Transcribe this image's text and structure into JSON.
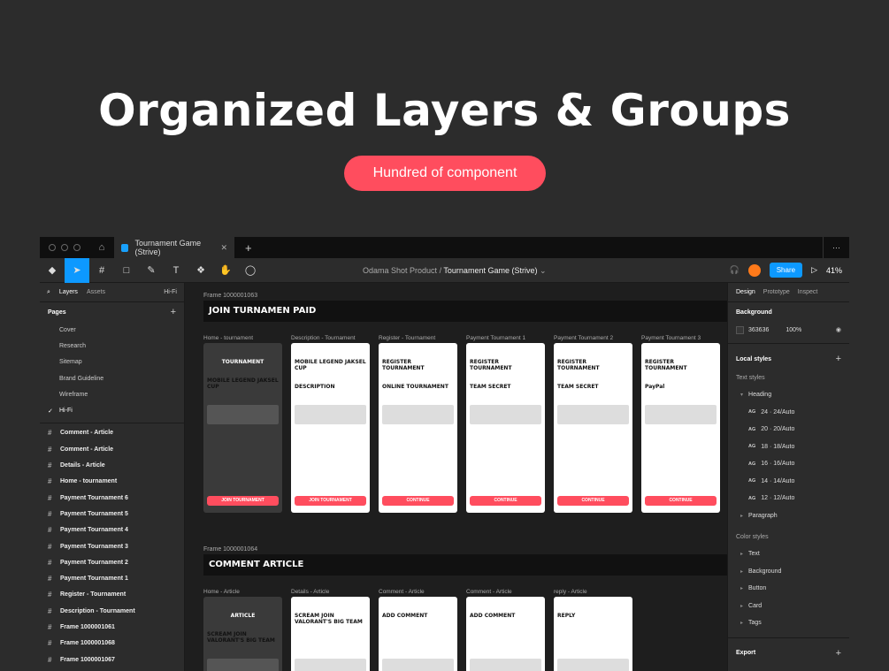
{
  "hero": {
    "title": "Organized Layers & Groups",
    "pill": "Hundred of component"
  },
  "tabbar": {
    "tab_title": "Tournament Game (Strive)",
    "close": "✕",
    "add": "+",
    "more": "⋯"
  },
  "toolbar": {
    "project": "Odama Shot Product",
    "separator": "/",
    "file": "Tournament Game (Strive)",
    "share_label": "Share",
    "zoom": "41%"
  },
  "left_panel": {
    "tab_layers": "Layers",
    "tab_assets": "Assets",
    "page_switch": "Hi-Fi",
    "pages_title": "Pages",
    "pages_add": "+",
    "pages": [
      "Cover",
      "Research",
      "Sitemap",
      "Brand Guideline",
      "Wireframe",
      "Hi-Fi"
    ],
    "current_page_check": "✓",
    "layers": [
      "Comment - Article",
      "Comment - Article",
      "Details - Article",
      "Home - tournament",
      "Payment Tournament 6",
      "Payment Tournament 5",
      "Payment Tournament 4",
      "Payment Tournament 3",
      "Payment Tournament 2",
      "Payment Tournament 1",
      "Register - Tournament",
      "Description - Tournament",
      "Frame 1000001061",
      "Frame 1000001068",
      "Frame 1000001067"
    ]
  },
  "canvas": {
    "frame1_label": "Frame 1000001063",
    "frame1_banner": "JOIN TURNAMEN PAID",
    "frame2_label": "Frame 1000001064",
    "frame2_banner": "COMMENT ARTICLE",
    "row1_screens": [
      {
        "label": "Home - tournament",
        "title": "TOURNAMENT",
        "subtitle": "MOBILE LEGEND JAKSEL CUP",
        "button": "JOIN TOURNAMENT"
      },
      {
        "label": "Description - Tournament",
        "title": "MOBILE LEGEND JAKSEL CUP",
        "subtitle": "DESCRIPTION",
        "button": "JOIN TOURNAMENT"
      },
      {
        "label": "Register - Tournament",
        "title": "REGISTER TOURNAMENT",
        "subtitle": "ONLINE TOURNAMENT",
        "button": "CONTINUE"
      },
      {
        "label": "Payment Tournament 1",
        "title": "REGISTER TOURNAMENT",
        "subtitle": "TEAM SECRET",
        "button": "CONTINUE"
      },
      {
        "label": "Payment Tournament 2",
        "title": "REGISTER TOURNAMENT",
        "subtitle": "TEAM SECRET",
        "button": "CONTINUE"
      },
      {
        "label": "Payment Tournament 3",
        "title": "REGISTER TOURNAMENT",
        "subtitle": "PayPal",
        "button": "CONTINUE"
      }
    ],
    "row2_screens": [
      {
        "label": "Home - Article",
        "title": "ARTICLE",
        "subtitle": "SCREAM JOIN VALORANT'S BIG TEAM"
      },
      {
        "label": "Details - Article",
        "title": "SCREAM JOIN VALORANT'S BIG TEAM"
      },
      {
        "label": "Comment - Article",
        "title": "ADD COMMENT"
      },
      {
        "label": "Comment - Article",
        "title": "ADD COMMENT"
      },
      {
        "label": "reply - Article",
        "title": "REPLY"
      }
    ]
  },
  "right_panel": {
    "tab_design": "Design",
    "tab_prototype": "Prototype",
    "tab_inspect": "Inspect",
    "background_title": "Background",
    "bg_hex": "363636",
    "bg_opacity": "100%",
    "local_styles": "Local styles",
    "add": "+",
    "text_styles": "Text styles",
    "heading": "Heading",
    "heading_styles": [
      "24 · 24/Auto",
      "20 · 20/Auto",
      "18 · 18/Auto",
      "16 · 16/Auto",
      "14 · 14/Auto",
      "12 · 12/Auto"
    ],
    "ag": "AG",
    "paragraph": "Paragraph",
    "color_styles": "Color styles",
    "color_items": [
      "Text",
      "Background",
      "Button",
      "Card",
      "Tags"
    ],
    "export": "Export"
  }
}
